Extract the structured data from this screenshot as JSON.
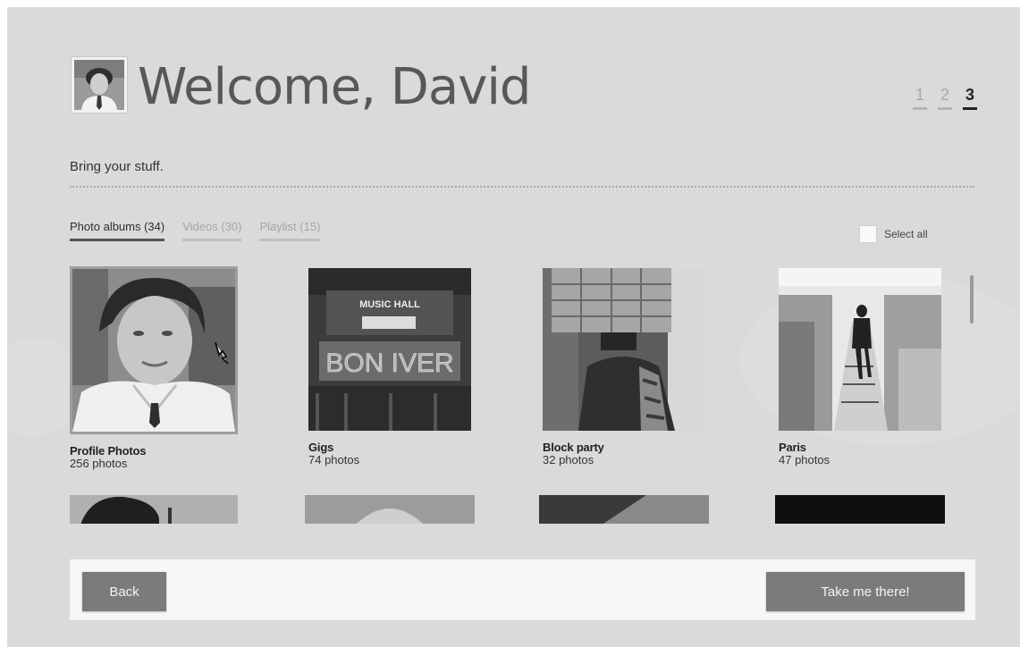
{
  "header": {
    "title": "Welcome, David",
    "steps": [
      {
        "label": "1",
        "active": false
      },
      {
        "label": "2",
        "active": false
      },
      {
        "label": "3",
        "active": true
      }
    ]
  },
  "subtitle": "Bring your stuff.",
  "tabs": [
    {
      "label": "Photo albums (34)",
      "active": true
    },
    {
      "label": "Videos (30)",
      "active": false
    },
    {
      "label": "Playlist (15)",
      "active": false
    }
  ],
  "select_all": {
    "label": "Select all",
    "checked": false
  },
  "albums": [
    {
      "title": "Profile Photos",
      "count": "256 photos",
      "selected": true,
      "icon": "portrait-photo"
    },
    {
      "title": "Gigs",
      "count": "74 photos",
      "selected": false,
      "icon": "music-hall-photo"
    },
    {
      "title": "Block party",
      "count": "32 photos",
      "selected": false,
      "icon": "costume-photo"
    },
    {
      "title": "Paris",
      "count": "47 photos",
      "selected": false,
      "icon": "memorial-photo"
    }
  ],
  "photo_text": {
    "music_hall": "MUSIC HALL",
    "bon_iver": "BON IVER"
  },
  "footer": {
    "back_label": "Back",
    "go_label": "Take me there!"
  },
  "colors": {
    "background": "#dadada",
    "button": "#7b7b7b",
    "active_step": "#222222",
    "footer_bar": "#f7f7f7"
  }
}
